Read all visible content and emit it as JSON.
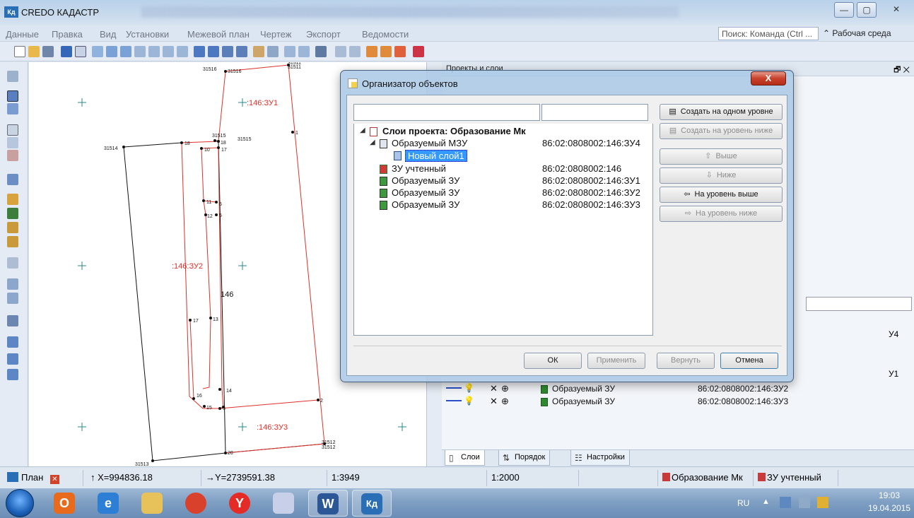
{
  "window": {
    "title": "CREDO КАДАСТР",
    "minimize": "—",
    "maximize": "▢",
    "close": "✕"
  },
  "menu": {
    "items": [
      "Данные",
      "Правка",
      "Вид",
      "Установки",
      "Межевой план",
      "Чертеж",
      "Экспорт",
      "Ведомости"
    ],
    "search_placeholder": "Поиск: Команда (Ctrl ...",
    "workspace": "Рабочая среда"
  },
  "map": {
    "labels": [
      {
        "text": "31516",
        "kind": "point"
      },
      {
        "text": "31516",
        "kind": "point"
      },
      {
        "text": "31511",
        "kind": "point"
      },
      {
        "text": "31511",
        "kind": "point"
      },
      {
        "text": ":146:ЗУ1",
        "kind": "parcel"
      },
      {
        "text": ":146:ЗУ2",
        "kind": "parcel"
      },
      {
        "text": ":146:ЗУ3",
        "kind": "parcel"
      },
      {
        "text": "146",
        "kind": "main"
      },
      {
        "text": "31514",
        "kind": "point"
      },
      {
        "text": "18",
        "kind": "point"
      },
      {
        "text": "31515",
        "kind": "point"
      },
      {
        "text": "31515",
        "kind": "point"
      },
      {
        "text": "18",
        "kind": "point"
      },
      {
        "text": "10",
        "kind": "point"
      },
      {
        "text": "17",
        "kind": "point"
      },
      {
        "text": "1",
        "kind": "point"
      },
      {
        "text": "11",
        "kind": "point"
      },
      {
        "text": "6",
        "kind": "point"
      },
      {
        "text": "12",
        "kind": "point"
      },
      {
        "text": "5",
        "kind": "point"
      },
      {
        "text": "17",
        "kind": "point"
      },
      {
        "text": "13",
        "kind": "point"
      },
      {
        "text": "16",
        "kind": "point"
      },
      {
        "text": "14",
        "kind": "point"
      },
      {
        "text": "15",
        "kind": "point"
      },
      {
        "text": "3",
        "kind": "point"
      },
      {
        "text": "2",
        "kind": "point"
      },
      {
        "text": "31512",
        "kind": "point"
      },
      {
        "text": "31512",
        "kind": "point"
      },
      {
        "text": "31513",
        "kind": "point"
      },
      {
        "text": "20",
        "kind": "point"
      }
    ]
  },
  "right_panel": {
    "title": "Проекты и слои",
    "rows": [
      {
        "name": "Образуемый ЗУ",
        "code": "86:02:0808002:146:ЗУ2"
      },
      {
        "name": "Образуемый ЗУ",
        "code": "86:02:0808002:146:ЗУ3"
      }
    ],
    "partial_code_a": "У4",
    "partial_code_b": "У1",
    "tabs": [
      "Слои",
      "Порядок",
      "Настройки"
    ]
  },
  "dialog": {
    "title": "Организатор объектов",
    "close_label": "X",
    "tree": {
      "root": "Слои проекта: Образование Мк",
      "items": [
        {
          "label": "Образуемый МЗУ",
          "code": "86:02:0808002:146:ЗУ4"
        },
        {
          "label": "Новый слой1",
          "code": ""
        },
        {
          "label": "ЗУ учтенный",
          "code": "86:02:0808002:146"
        },
        {
          "label": "Образуемый ЗУ",
          "code": "86:02:0808002:146:ЗУ1"
        },
        {
          "label": "Образуемый ЗУ",
          "code": "86:02:0808002:146:ЗУ2"
        },
        {
          "label": "Образуемый ЗУ",
          "code": "86:02:0808002:146:ЗУ3"
        }
      ]
    },
    "buttons": {
      "create_same": "Создать на одном уровне",
      "create_below": "Создать на уровень ниже",
      "up": "Выше",
      "down": "Ниже",
      "level_up": "На уровень выше",
      "level_down": "На уровень ниже",
      "ok": "ОК",
      "apply": "Применить",
      "revert": "Вернуть",
      "cancel": "Отмена"
    }
  },
  "status": {
    "view": "План",
    "x": "↑ X=994836.18",
    "y": "→Y=2739591.38",
    "scale1": "1:3949",
    "scale2": "1:2000",
    "project": "Образование Мк",
    "layer": "ЗУ учтенный"
  },
  "taskbar": {
    "lang": "RU",
    "time": "19:03",
    "date": "19.04.2015"
  },
  "colors": {
    "parcel_line": "#e0302a",
    "main_line": "#111111",
    "cross": "#2a8a8a",
    "highlight": "#3399ff"
  }
}
